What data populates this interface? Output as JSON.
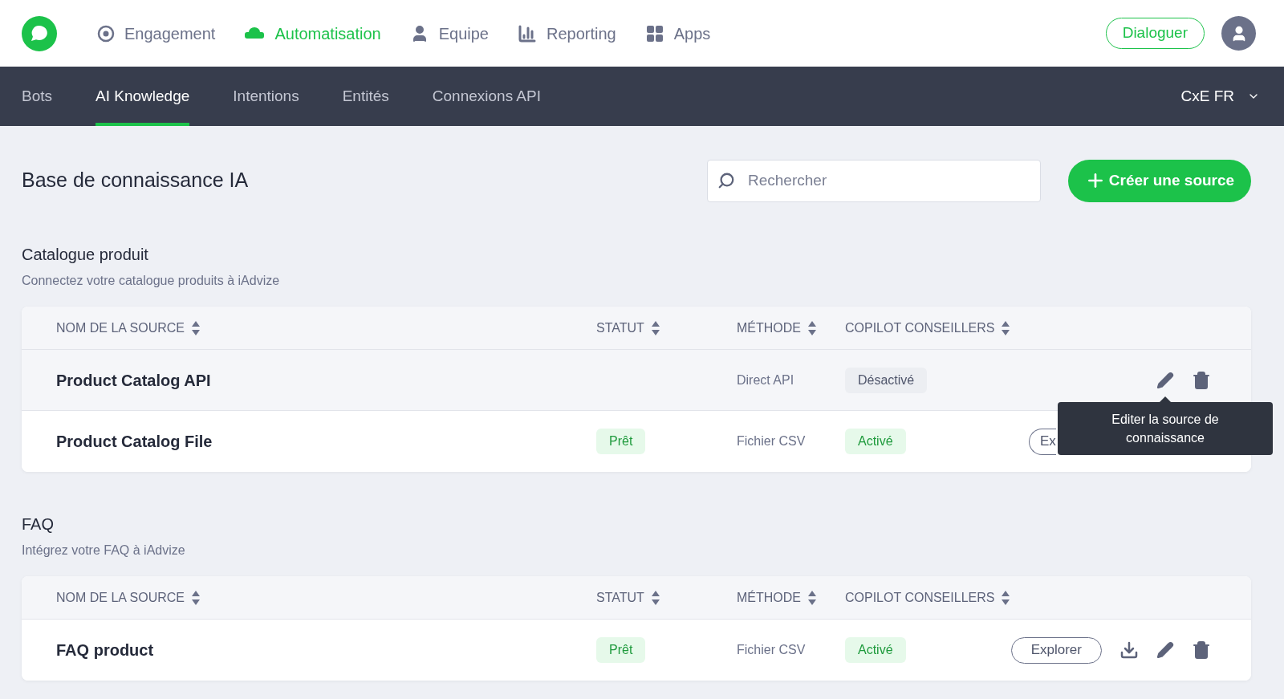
{
  "top_nav": {
    "items": [
      {
        "label": "Engagement",
        "kind": "target",
        "selected": false
      },
      {
        "label": "Automatisation",
        "kind": "bot",
        "selected": true
      },
      {
        "label": "Equipe",
        "kind": "person",
        "selected": false
      },
      {
        "label": "Reporting",
        "kind": "bars",
        "selected": false
      },
      {
        "label": "Apps",
        "kind": "grid",
        "selected": false
      }
    ],
    "action": "Dialoguer"
  },
  "sub_nav": {
    "tabs": [
      {
        "label": "Bots",
        "selected": false
      },
      {
        "label": "AI Knowledge",
        "selected": true
      },
      {
        "label": "Intentions",
        "selected": false
      },
      {
        "label": "Entités",
        "selected": false
      },
      {
        "label": "Connexions API",
        "selected": false
      }
    ],
    "account": "CxE FR"
  },
  "page": {
    "title": "Base de connaissance IA",
    "search": {
      "placeholder": "Rechercher"
    },
    "create_button": "Créer une source"
  },
  "sections": [
    {
      "title": "Catalogue produit",
      "subtitle": "Connectez votre catalogue produits à iAdvize",
      "columns": [
        "NOM DE LA SOURCE",
        "STATUT",
        "MÉTHODE",
        "COPILOT CONSEILLERS"
      ],
      "rows": [
        {
          "name": "Product Catalog API",
          "method": "Direct API",
          "copilot": {
            "label": "Désactivé",
            "active": false
          },
          "actions": [
            {
              "kind": "edit",
              "tooltip": "Editer la source de connaissance"
            },
            {
              "kind": "delete"
            }
          ]
        },
        {
          "name": "Product Catalog File",
          "status": "Prêt",
          "method": "Fichier CSV",
          "copilot": {
            "label": "Activé",
            "active": true
          },
          "actions": [
            {
              "kind": "explore",
              "label": "Ex",
              "clipped": true
            }
          ]
        }
      ]
    },
    {
      "title": "FAQ",
      "subtitle": "Intégrez votre FAQ à iAdvize",
      "columns": [
        "NOM DE LA SOURCE",
        "STATUT",
        "MÉTHODE",
        "COPILOT CONSEILLERS"
      ],
      "rows": [
        {
          "name": "FAQ product",
          "status": "Prêt",
          "method": "Fichier CSV",
          "copilot": {
            "label": "Activé",
            "active": true
          },
          "actions": [
            {
              "kind": "explore",
              "label": "Explorer",
              "clipped": false
            },
            {
              "kind": "download"
            },
            {
              "kind": "edit"
            },
            {
              "kind": "delete"
            }
          ]
        }
      ]
    }
  ]
}
